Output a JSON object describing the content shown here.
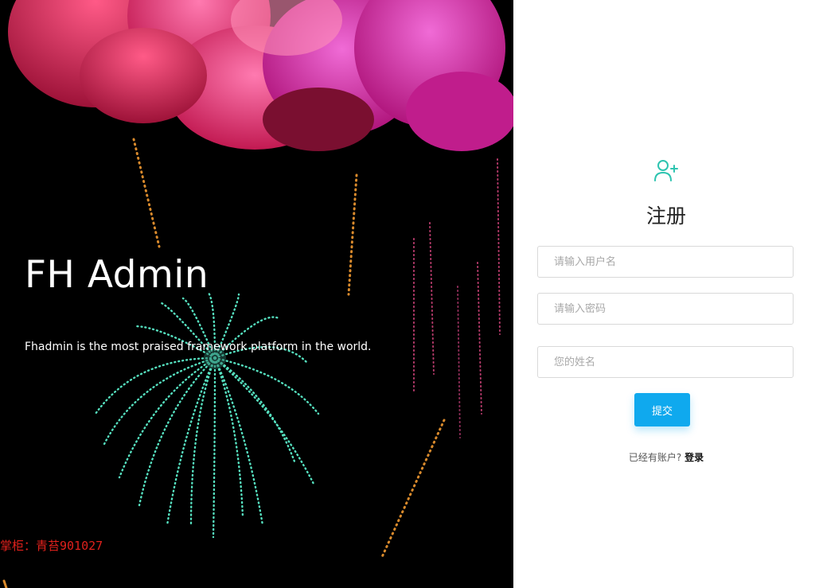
{
  "hero": {
    "title": "FH Admin",
    "subtitle": "Fhadmin is the most praised framework platform in the world.",
    "watermark": "掌柜：青苔901027"
  },
  "form": {
    "title": "注册",
    "username_placeholder": "请输入用户名",
    "password_placeholder": "请输入密码",
    "name_placeholder": "您的姓名",
    "submit_label": "提交",
    "have_account_text": "已经有账户? ",
    "login_link": "登录",
    "icon": "user-plus-icon"
  },
  "colors": {
    "accent": "#0fa9ee",
    "icon": "#2ec4b0",
    "watermark": "#e0211c",
    "hero_bg": "#000000"
  }
}
